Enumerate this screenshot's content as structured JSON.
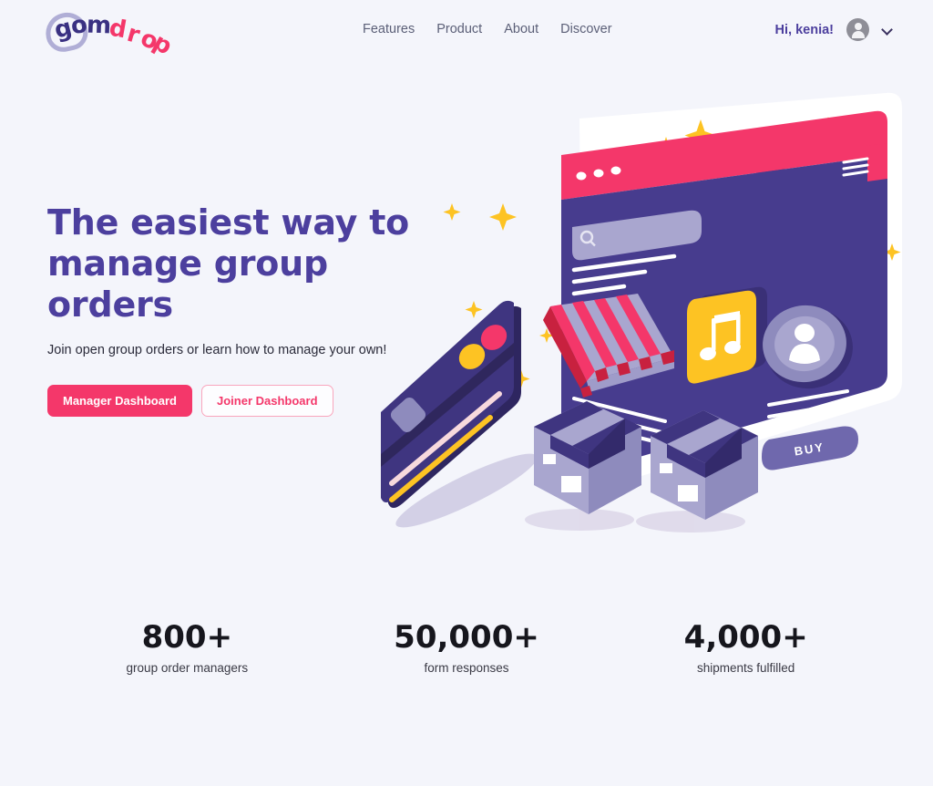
{
  "brand": {
    "logo_text": "gomdrop",
    "logo_letters": [
      "g",
      "o",
      "m",
      "d",
      "r",
      "o",
      "p"
    ],
    "logo_primary_color": "#3a3182",
    "logo_accent_color": "#f4376a"
  },
  "header": {
    "nav": [
      {
        "label": "Features"
      },
      {
        "label": "Product"
      },
      {
        "label": "About"
      },
      {
        "label": "Discover"
      }
    ],
    "greeting": "Hi, kenia!",
    "avatar_icon": "user-avatar-icon",
    "dropdown_icon": "chevron-down-icon"
  },
  "hero": {
    "title_line1": "The easiest way to",
    "title_line2": "manage group orders",
    "subtitle": "Join open group orders or learn how to manage your own!",
    "primary_button": "Manager Dashboard",
    "secondary_button": "Joiner Dashboard",
    "title_color": "#4c3f9e",
    "primary_button_color": "#f4376a"
  },
  "illustration": {
    "name": "isometric-ecommerce-illustration",
    "browser_window": {
      "top_bar_color": "#f4376a",
      "body_color": "#473c8e",
      "dots": 3,
      "menu_icon": "hamburger-menu-icon",
      "search_icon": "search-icon",
      "buy_button_label": "BUY",
      "music_card_icon": "music-note-icon",
      "music_card_color": "#fdc323",
      "profile_icon": "user-avatar-icon"
    },
    "storefront_awning": {
      "stripe_colors": [
        "#f4376a",
        "#a9a6cf"
      ]
    },
    "credit_card": {
      "color": "#3f3580",
      "chip": true,
      "circles": [
        "#fdc323",
        "#f4376a"
      ]
    },
    "boxes": 2,
    "cloud_color": "#453a8e",
    "cloud_shadow_color": "#fbd4dd",
    "sparkle_color": "#fdc323"
  },
  "stats": [
    {
      "value": "800+",
      "label": "group order managers"
    },
    {
      "value": "50,000+",
      "label": "form responses"
    },
    {
      "value": "4,000+",
      "label": "shipments fulfilled"
    }
  ]
}
